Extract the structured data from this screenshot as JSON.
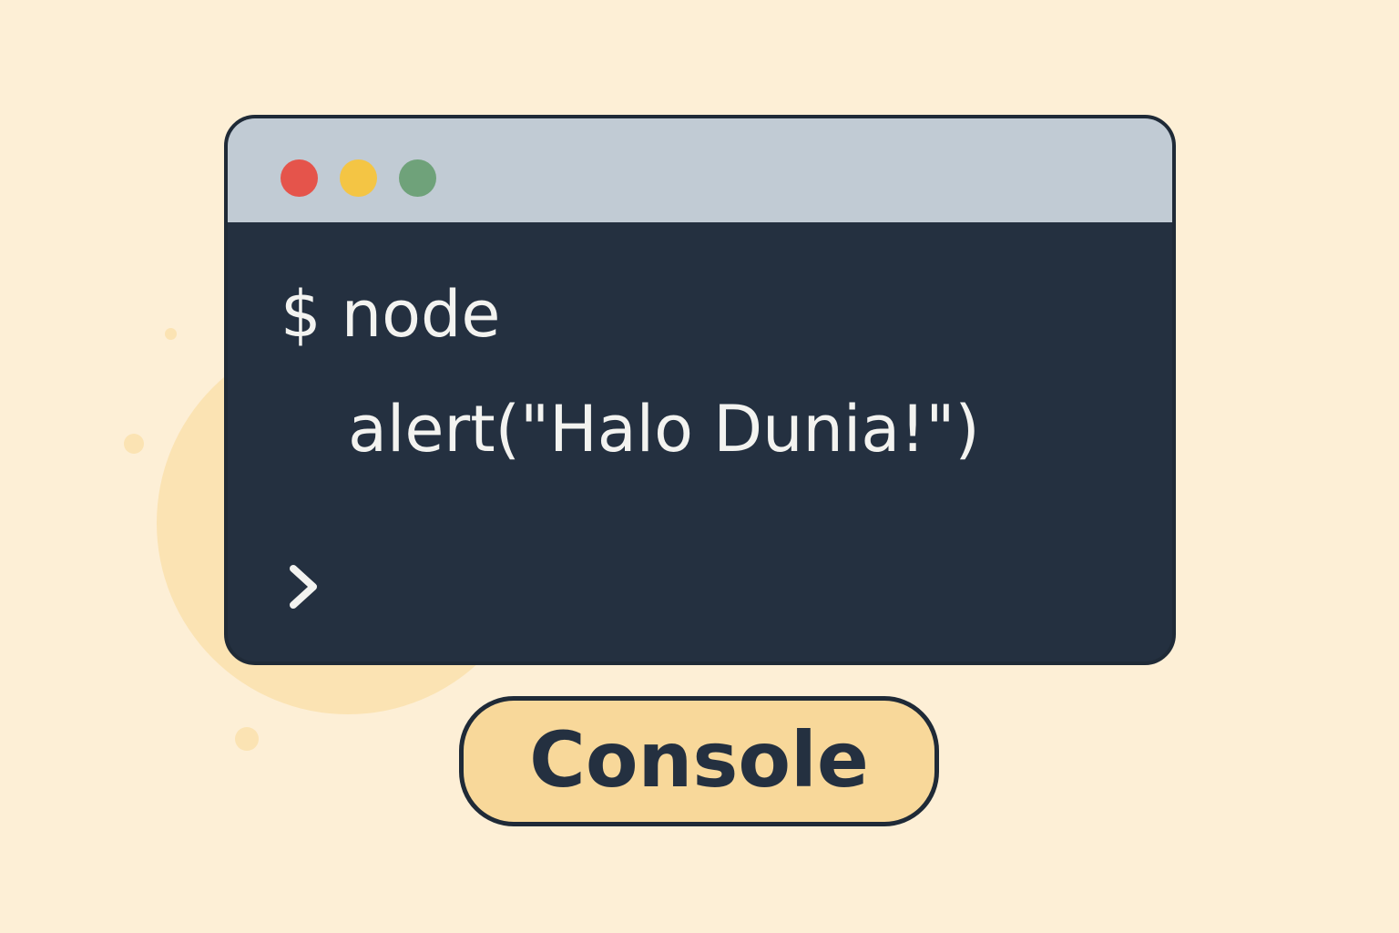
{
  "colors": {
    "background": "#fdefd6",
    "terminal_body": "#243040",
    "titlebar": "#c1cbd4",
    "close": "#e5544b",
    "minimize": "#f4c544",
    "maximize": "#6fa27a",
    "badge": "#f8d89a",
    "text": "#f3f3f0"
  },
  "terminal": {
    "window_controls": [
      "close-dot",
      "minimize-dot",
      "maximize-dot"
    ],
    "lines": [
      "$ node",
      "alert(\"Halo Dunia!\")"
    ],
    "prompt_icon": "chevron-right-icon"
  },
  "badge": {
    "label": "Console"
  }
}
